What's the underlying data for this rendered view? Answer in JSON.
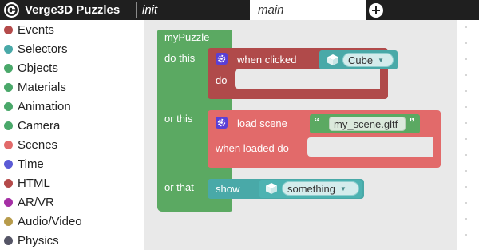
{
  "app": {
    "title": "Verge3D Puzzles",
    "logo_icon": "verge3d-logo-icon"
  },
  "tabs": [
    {
      "label": "init",
      "active": false
    },
    {
      "label": "main",
      "active": true
    }
  ],
  "toolbox": {
    "categories": [
      {
        "label": "Events",
        "color": "#b44a4a"
      },
      {
        "label": "Selectors",
        "color": "#49a9a8"
      },
      {
        "label": "Objects",
        "color": "#4aa86a"
      },
      {
        "label": "Materials",
        "color": "#4aa86a"
      },
      {
        "label": "Animation",
        "color": "#4aa86a"
      },
      {
        "label": "Camera",
        "color": "#4aa86a"
      },
      {
        "label": "Scenes",
        "color": "#e26a6a"
      },
      {
        "label": "Time",
        "color": "#5b5bd6"
      },
      {
        "label": "HTML",
        "color": "#b44a4a"
      },
      {
        "label": "AR/VR",
        "color": "#a52fa5"
      },
      {
        "label": "Audio/Video",
        "color": "#b79b4b"
      },
      {
        "label": "Physics",
        "color": "#555566"
      }
    ]
  },
  "puzzle": {
    "name": "myPuzzle",
    "do_this_label": "do this",
    "or_this_label": "or this",
    "or_that_label": "or that",
    "when_clicked": {
      "label": "when clicked",
      "object": "Cube",
      "do_label": "do"
    },
    "load_scene": {
      "label": "load scene",
      "filename": "my_scene.gltf",
      "when_loaded_label": "when loaded do"
    },
    "show": {
      "label": "show",
      "object": "something"
    }
  },
  "colors": {
    "topbar": "#1f1f1f",
    "procedure_block": "#5ba962",
    "event_block": "#b04a4a",
    "scene_block": "#e26a6a",
    "selector_block": "#49a9a8",
    "workspace": "#e9e9e9"
  }
}
